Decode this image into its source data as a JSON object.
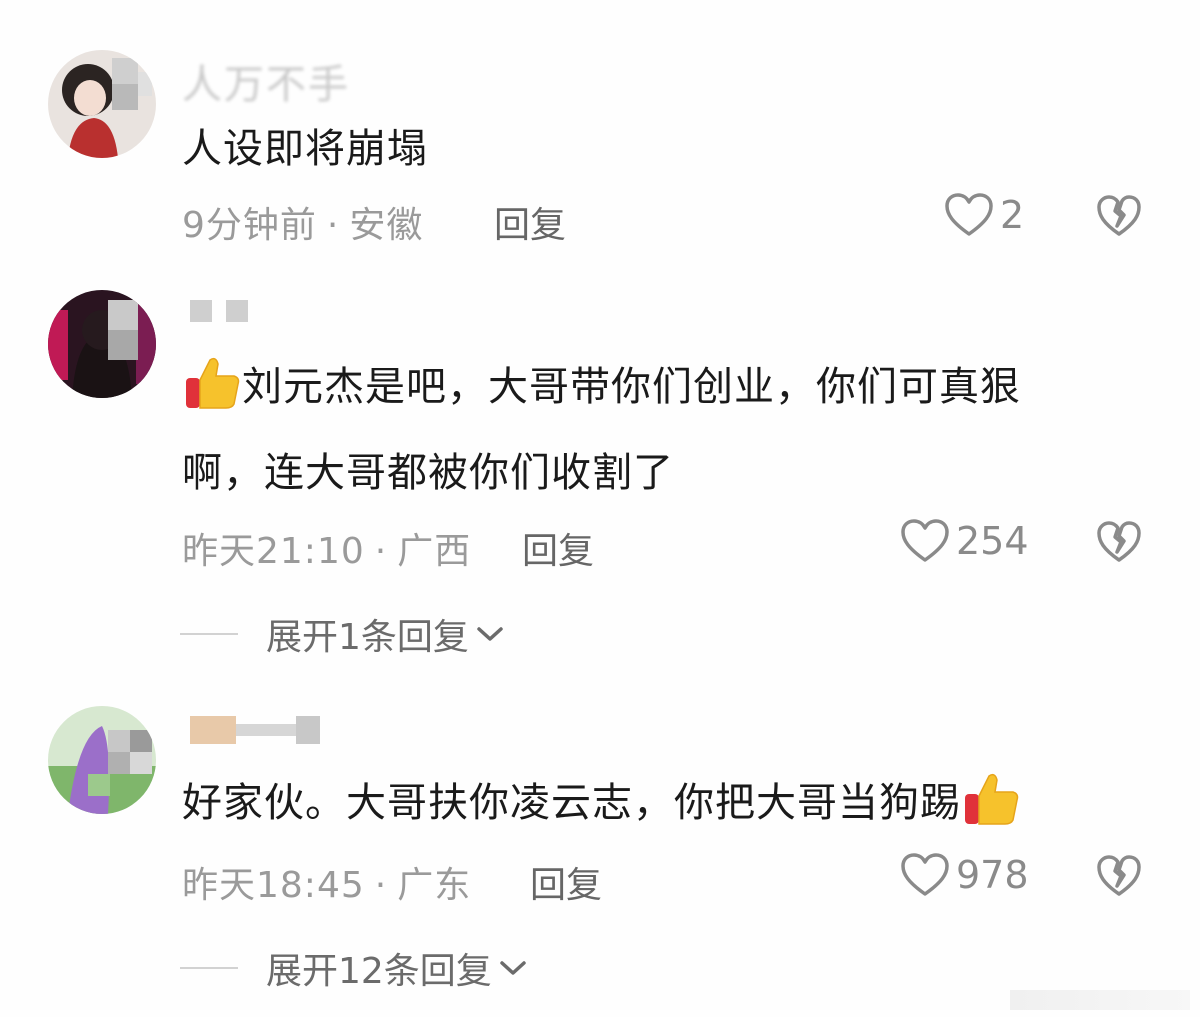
{
  "comments": [
    {
      "username": "人万不手",
      "text": "人设即将崩塌",
      "time": "9分钟前",
      "location": "安徽",
      "reply_label": "回复",
      "likes": "2"
    },
    {
      "username": "",
      "text_line1": "刘元杰是吧，大哥带你们创业，你们可真狠",
      "text_line2": "啊，连大哥都被你们收割了",
      "time": "昨天21:10",
      "location": "广西",
      "reply_label": "回复",
      "likes": "254",
      "expand_label": "展开1条回复"
    },
    {
      "username": "",
      "text": "好家伙。大哥扶你凌云志，你把大哥当狗踢",
      "time": "昨天18:45",
      "location": "广东",
      "reply_label": "回复",
      "likes": "978",
      "expand_label": "展开12条回复"
    }
  ],
  "separator": "·",
  "icons": {
    "like": "heart-outline-icon",
    "dislike": "broken-heart-icon",
    "expand": "chevron-down-icon",
    "emoji": "thumbs-up-emoji"
  }
}
